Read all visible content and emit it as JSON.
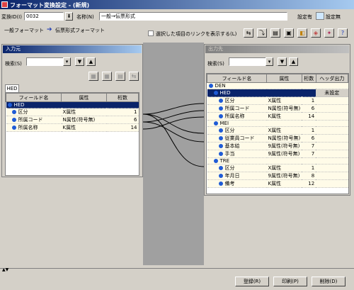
{
  "window": {
    "title": "フォーマット変換設定 - (新規)"
  },
  "header": {
    "id_label": "変換ID(I)",
    "id_value": "0032",
    "name_label": "名称(N)",
    "name_value": "一般→伝票形式",
    "setting_label_1": "設定有",
    "setting_label_2": "設定無"
  },
  "formats": {
    "source": "一般フォーマット",
    "arrow": "➔",
    "target": "伝票形式フォーマット"
  },
  "toolbar": {
    "show_links_label": "選択した項目のリンクを表示する(L)"
  },
  "input_panel": {
    "title": "入力元",
    "search_label": "検索(S)",
    "tab": "HED",
    "headers": [
      "フィールド名",
      "属性",
      "桁数"
    ],
    "rows": [
      {
        "name": "HED",
        "attr": "",
        "digits": "",
        "selected": true,
        "level": 0
      },
      {
        "name": "区分",
        "attr": "X属性",
        "digits": "1",
        "level": 1
      },
      {
        "name": "所属コード",
        "attr": "N属性(符号無)",
        "digits": "6",
        "level": 1
      },
      {
        "name": "所属名称",
        "attr": "K属性",
        "digits": "14",
        "level": 1
      }
    ]
  },
  "output_panel": {
    "title": "出力先",
    "search_label": "検索(S)",
    "headers": [
      "フィールド名",
      "属性",
      "桁数",
      "ヘッダ出力"
    ],
    "rows": [
      {
        "name": "DEN",
        "attr": "",
        "digits": "",
        "header": "",
        "level": 0
      },
      {
        "name": "HED",
        "attr": "",
        "digits": "",
        "header": "未設定",
        "selected": true,
        "level": 1
      },
      {
        "name": "区分",
        "attr": "X属性",
        "digits": "1",
        "header": "",
        "level": 2
      },
      {
        "name": "所属コード",
        "attr": "N属性(符号無)",
        "digits": "6",
        "header": "",
        "level": 2
      },
      {
        "name": "所属名称",
        "attr": "K属性",
        "digits": "14",
        "header": "",
        "level": 2
      },
      {
        "name": "MEI",
        "attr": "",
        "digits": "",
        "header": "",
        "level": 1
      },
      {
        "name": "区分",
        "attr": "X属性",
        "digits": "1",
        "header": "",
        "level": 2
      },
      {
        "name": "従業員コード",
        "attr": "N属性(符号無)",
        "digits": "6",
        "header": "",
        "level": 2
      },
      {
        "name": "基本給",
        "attr": "9属性(符号無)",
        "digits": "7",
        "header": "",
        "level": 2
      },
      {
        "name": "手当",
        "attr": "9属性(符号無)",
        "digits": "7",
        "header": "",
        "level": 2
      },
      {
        "name": "TRE",
        "attr": "",
        "digits": "",
        "header": "",
        "level": 1
      },
      {
        "name": "区分",
        "attr": "X属性",
        "digits": "1",
        "header": "",
        "level": 2
      },
      {
        "name": "年月日",
        "attr": "9属性(符号無)",
        "digits": "8",
        "header": "",
        "level": 2
      },
      {
        "name": "備考",
        "attr": "K属性",
        "digits": "12",
        "header": "",
        "level": 2
      }
    ]
  },
  "footer": {
    "register": "登録(R)",
    "print": "印刷(P)",
    "delete": "削除(D)"
  },
  "colors": {
    "setting_on": "#cfe8ff",
    "setting_off": "#f5f0c8"
  }
}
